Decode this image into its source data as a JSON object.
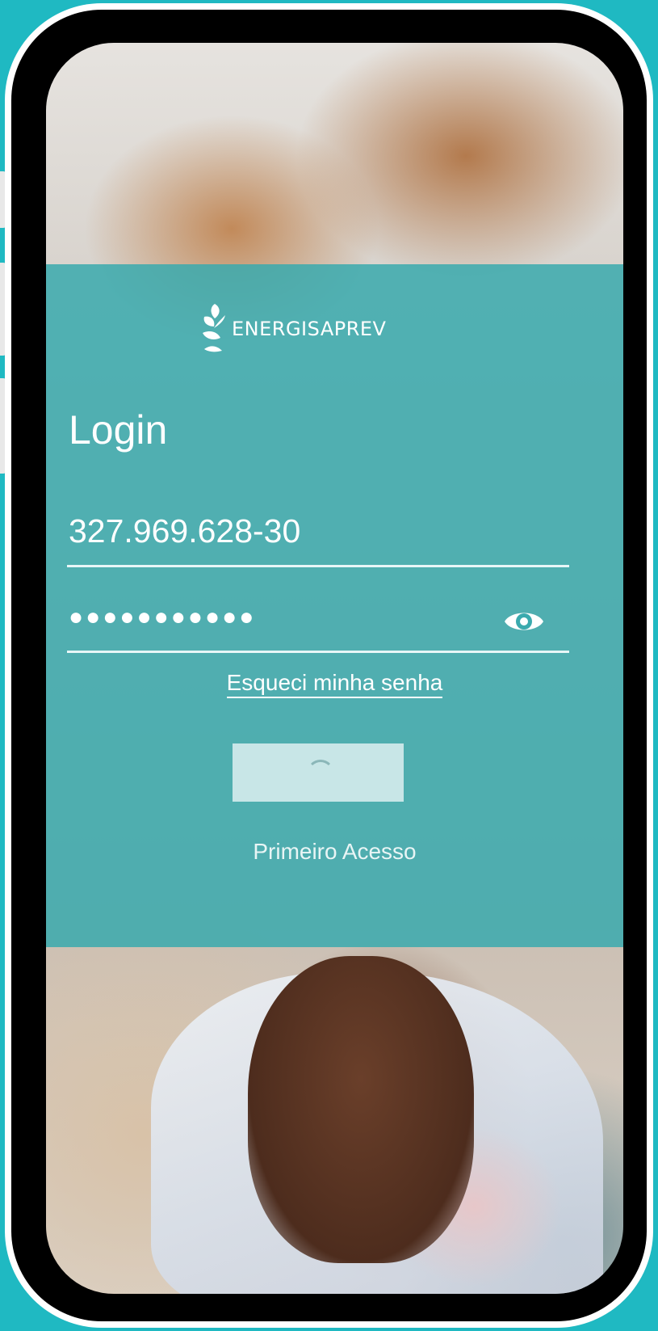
{
  "brand": {
    "logo_text": "energisaprev",
    "accent": "#3aaaae",
    "frame_color": "#1fb9c2"
  },
  "login": {
    "title": "Login",
    "cpf_value": "327.969.628-30",
    "password_value": "●●●●●●●●●●●",
    "toggle_icon": "eye-icon",
    "forgot_label": "Esqueci minha senha",
    "submit_state": "loading",
    "first_access_label": "Primeiro Acesso"
  }
}
